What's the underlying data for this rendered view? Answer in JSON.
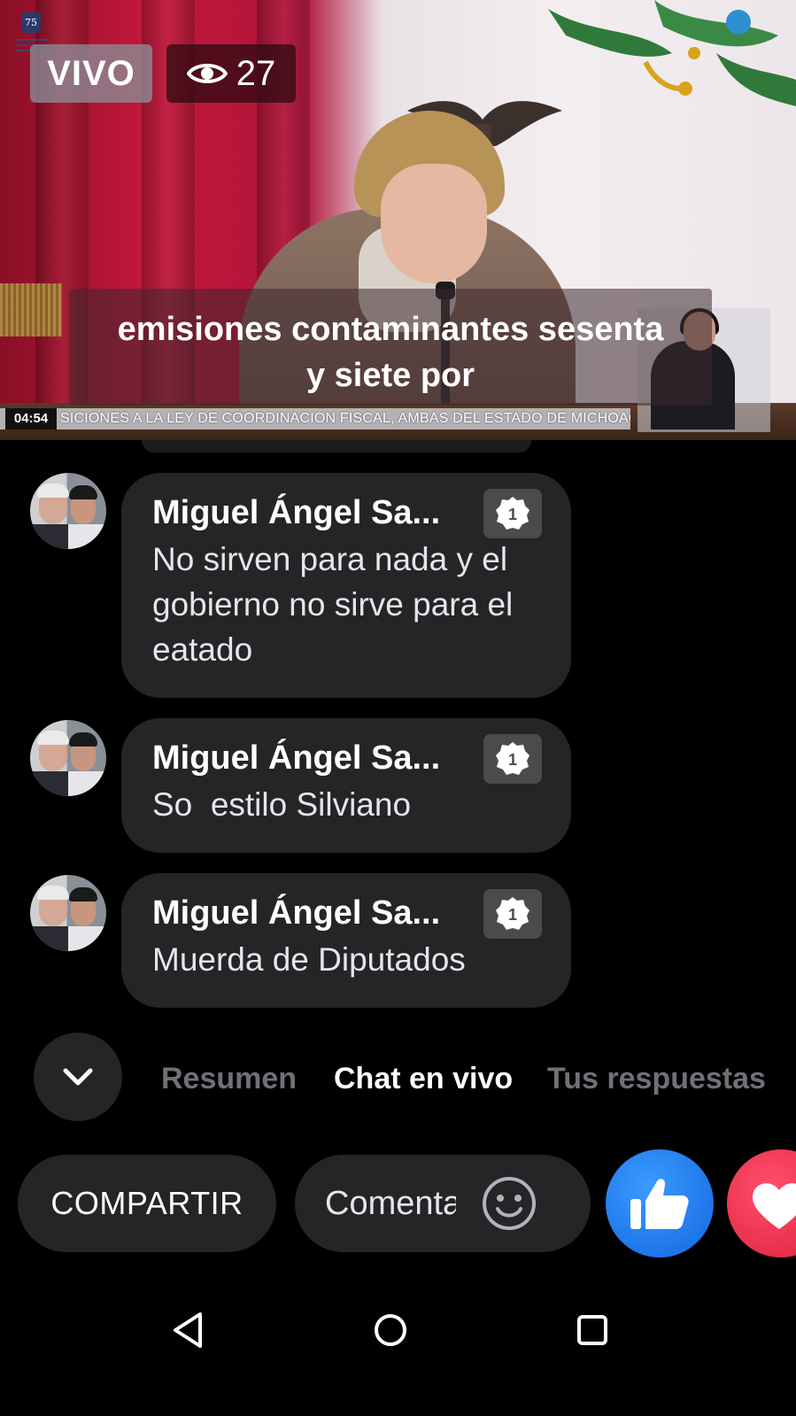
{
  "video": {
    "live_label": "VIVO",
    "viewer_count": "27",
    "caption_line1": "emisiones contaminantes sesenta",
    "caption_line2": "y siete por",
    "elapsed_time": "04:54",
    "ticker_text": "SICIONES A LA LEY DE COORDINACIÓN FISCAL,  AMBAS DEL ESTADO DE MICHOACÁN",
    "logo_text": "75"
  },
  "comments": [
    {
      "author": "Miguel Ángel Sa...",
      "message": "No sirven para nada y el gobierno no sirve para el eatado",
      "rank_badge": "1"
    },
    {
      "author": "Miguel Ángel Sa...",
      "message": "So  estilo Silviano",
      "rank_badge": "1"
    },
    {
      "author": "Miguel Ángel Sa...",
      "message": "Muerda de Diputados",
      "rank_badge": "1"
    }
  ],
  "tabs": [
    {
      "label": "Resumen",
      "active": false
    },
    {
      "label": "Chat en vivo",
      "active": true
    },
    {
      "label": "Tus respuestas",
      "active": false
    }
  ],
  "actions": {
    "share_label": "COMPARTIR",
    "comment_placeholder": "Comentar...",
    "like_icon": "thumbs-up-icon",
    "love_icon": "heart-icon"
  },
  "colors": {
    "background": "#000000",
    "bubble": "#242526",
    "like_blue": "#1877f2",
    "love_red": "#f02849"
  }
}
